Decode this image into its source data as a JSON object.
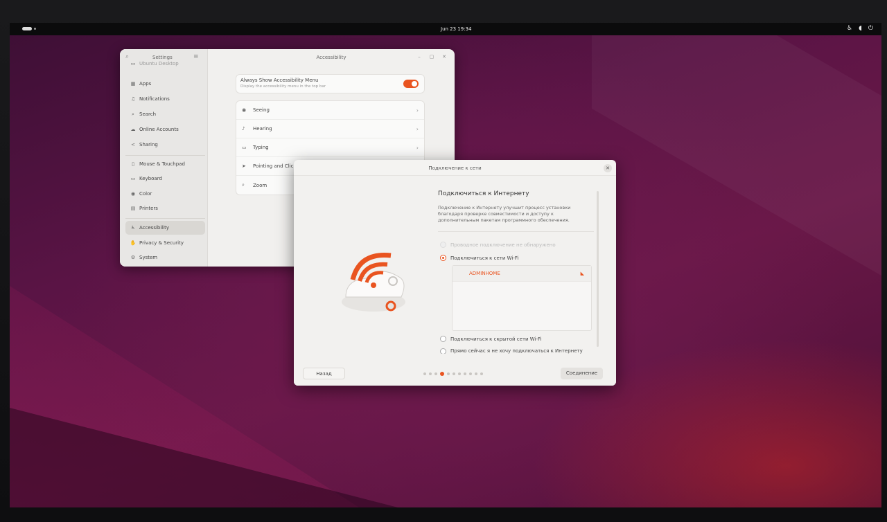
{
  "topbar": {
    "clock": "Jun 23  19:34",
    "icons": [
      "accessibility-icon",
      "volume-icon",
      "power-icon"
    ]
  },
  "settings": {
    "sidebar_title": "Settings",
    "window_title": "Accessibility",
    "sidebar": {
      "partial_top": "Ubuntu Desktop",
      "items": [
        {
          "label": "Apps",
          "icon": "apps-icon"
        },
        {
          "label": "Notifications",
          "icon": "bell-icon"
        },
        {
          "label": "Search",
          "icon": "search-icon"
        },
        {
          "label": "Online Accounts",
          "icon": "cloud-icon"
        },
        {
          "label": "Sharing",
          "icon": "share-icon"
        },
        {
          "label": "Mouse & Touchpad",
          "icon": "mouse-icon"
        },
        {
          "label": "Keyboard",
          "icon": "keyboard-icon"
        },
        {
          "label": "Color",
          "icon": "color-icon"
        },
        {
          "label": "Printers",
          "icon": "printer-icon"
        },
        {
          "label": "Accessibility",
          "icon": "accessibility-icon"
        },
        {
          "label": "Privacy & Security",
          "icon": "hand-icon"
        },
        {
          "label": "System",
          "icon": "gear-icon"
        }
      ]
    },
    "menu_card": {
      "title": "Always Show Accessibility Menu",
      "subtitle": "Display the accessibility menu in the top bar",
      "enabled": true
    },
    "rows": [
      {
        "label": "Seeing",
        "icon": "eye-icon"
      },
      {
        "label": "Hearing",
        "icon": "ear-icon"
      },
      {
        "label": "Typing",
        "icon": "keyboard-icon"
      },
      {
        "label": "Pointing and Clicking",
        "icon": "pointer-icon"
      },
      {
        "label": "Zoom",
        "icon": "magnifier-icon"
      }
    ]
  },
  "dialog": {
    "title": "Подключение к сети",
    "heading": "Подключиться к Интернету",
    "description": "Подключение к Интернету улучшит процесс установки благодаря проверке совместимости и доступу к дополнительным пакетам программного обеспечения.",
    "options": [
      {
        "label": "Проводное подключение не обнаружено",
        "state": "disabled"
      },
      {
        "label": "Подключиться к сети Wi-Fi",
        "state": "checked"
      },
      {
        "label": "Подключиться к скрытой сети Wi-Fi",
        "state": "unchecked"
      },
      {
        "label": "Прямо сейчас я не хочу подключаться к Интернету",
        "state": "unchecked"
      }
    ],
    "networks": [
      {
        "ssid": "ADMINHOME"
      }
    ],
    "back_label": "Назад",
    "connect_label": "Соединение",
    "steps_total": 11,
    "current_step": 4,
    "accent_color": "#e95420"
  }
}
